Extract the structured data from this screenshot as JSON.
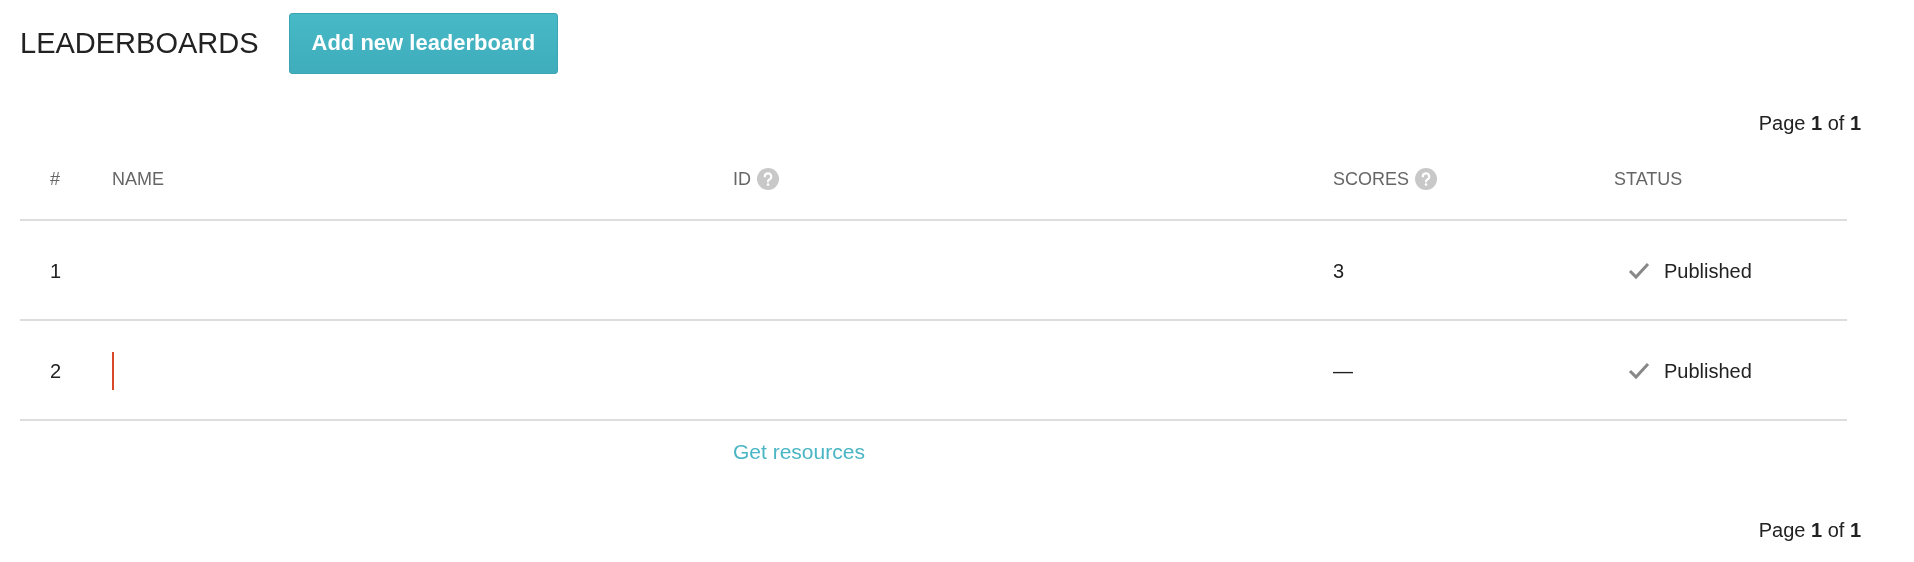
{
  "title": "LEADERBOARDS",
  "add_button": "Add new leaderboard",
  "pagination_top": "Page **1** of **1**",
  "table": {
    "columns": [
      {
        "label": "#",
        "help": false
      },
      {
        "label": "NAME",
        "help": false
      },
      {
        "label": "ID",
        "help": true
      },
      {
        "label": "SCORES",
        "help": true
      },
      {
        "label": "STATUS",
        "help": false
      }
    ],
    "rows": [
      {
        "number": "1",
        "scores": "3",
        "status": "Published",
        "published": true
      },
      {
        "number": "2",
        "scores": "—",
        "status": "Published",
        "published": true
      }
    ]
  },
  "footer_link": "Get resources",
  "pagination_bottom": "Page **1** of **1**"
}
